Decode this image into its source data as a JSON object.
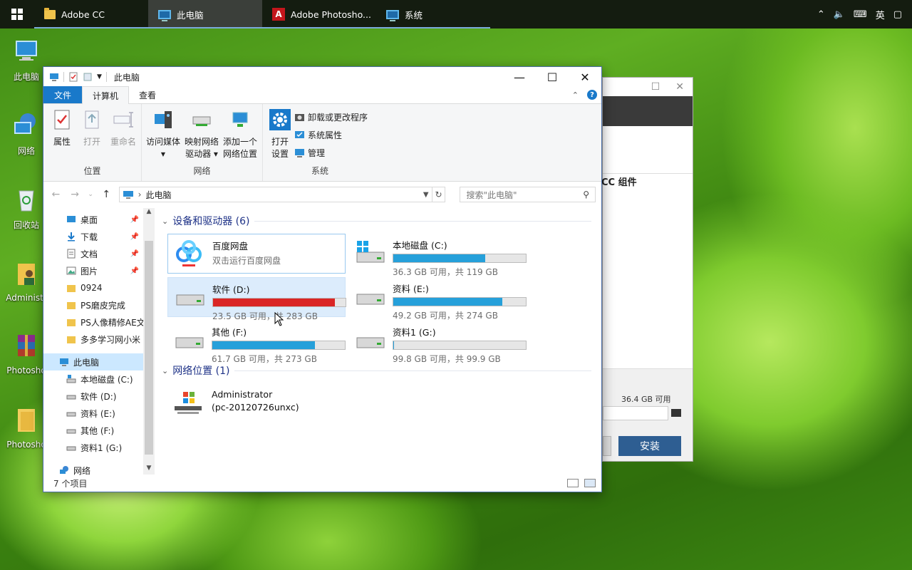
{
  "taskbar": {
    "items": [
      {
        "label": "Adobe CC",
        "icon": "folder-icon"
      },
      {
        "label": "此电脑",
        "icon": "computer-icon"
      },
      {
        "label": "Adobe Photosho...",
        "icon": "photoshop-icon"
      },
      {
        "label": "系统",
        "icon": "computer-icon"
      }
    ],
    "ime": "英"
  },
  "desktop": [
    {
      "label": "此电脑"
    },
    {
      "label": "网络"
    },
    {
      "label": "回收站"
    },
    {
      "label": "Administr"
    },
    {
      "label": "Photosho"
    },
    {
      "label": "Photosho"
    }
  ],
  "installer": {
    "header": "CC 组件",
    "free": "36.4 GB 可用",
    "install_label": "安装"
  },
  "explorer": {
    "title": "此电脑",
    "tabs": {
      "file": "文件",
      "computer": "计算机",
      "view": "查看"
    },
    "ribbon": {
      "location": {
        "label": "位置",
        "properties": "属性",
        "open": "打开",
        "rename": "重命名"
      },
      "network": {
        "label": "网络",
        "media": "访问媒体",
        "map_drive_1": "映射网络",
        "map_drive_2": "驱动器",
        "add_location_1": "添加一个",
        "add_location_2": "网络位置"
      },
      "system": {
        "label": "系统",
        "open_settings_1": "打开",
        "open_settings_2": "设置",
        "uninstall": "卸载或更改程序",
        "sys_props": "系统属性",
        "manage": "管理"
      }
    },
    "address": {
      "path": "此电脑",
      "search_placeholder": "搜索\"此电脑\""
    },
    "nav": [
      {
        "label": "桌面",
        "pinned": true
      },
      {
        "label": "下载",
        "pinned": true
      },
      {
        "label": "文档",
        "pinned": true
      },
      {
        "label": "图片",
        "pinned": true
      },
      {
        "label": "0924"
      },
      {
        "label": "PS磨皮完成"
      },
      {
        "label": "PS人像精修AE文"
      },
      {
        "label": "多多学习网小米"
      },
      {
        "label": "此电脑"
      },
      {
        "label": "本地磁盘 (C:)"
      },
      {
        "label": "软件 (D:)"
      },
      {
        "label": "资料 (E:)"
      },
      {
        "label": "其他 (F:)"
      },
      {
        "label": "资料1 (G:)"
      },
      {
        "label": "网络"
      }
    ],
    "sections": {
      "devices": "设备和驱动器 (6)",
      "network": "网络位置 (1)"
    },
    "baidu": {
      "name": "百度网盘",
      "sub": "双击运行百度网盘"
    },
    "drives": [
      {
        "name": "本地磁盘 (C:)",
        "info": "36.3 GB 可用，共 119 GB",
        "used_fraction": 0.695
      },
      {
        "name": "软件 (D:)",
        "info": "23.5 GB 可用，共 283 GB",
        "used_fraction": 0.917
      },
      {
        "name": "资料 (E:)",
        "info": "49.2 GB 可用，共 274 GB",
        "used_fraction": 0.82
      },
      {
        "name": "其他 (F:)",
        "info": "61.7 GB 可用，共 273 GB",
        "used_fraction": 0.774
      },
      {
        "name": "资料1 (G:)",
        "info": "99.8 GB 可用，共 99.9 GB",
        "used_fraction": 0.001
      }
    ],
    "network_item": {
      "name": "Administrator",
      "sub": "(pc-20120726unxc)"
    },
    "status": "7 个项目"
  }
}
